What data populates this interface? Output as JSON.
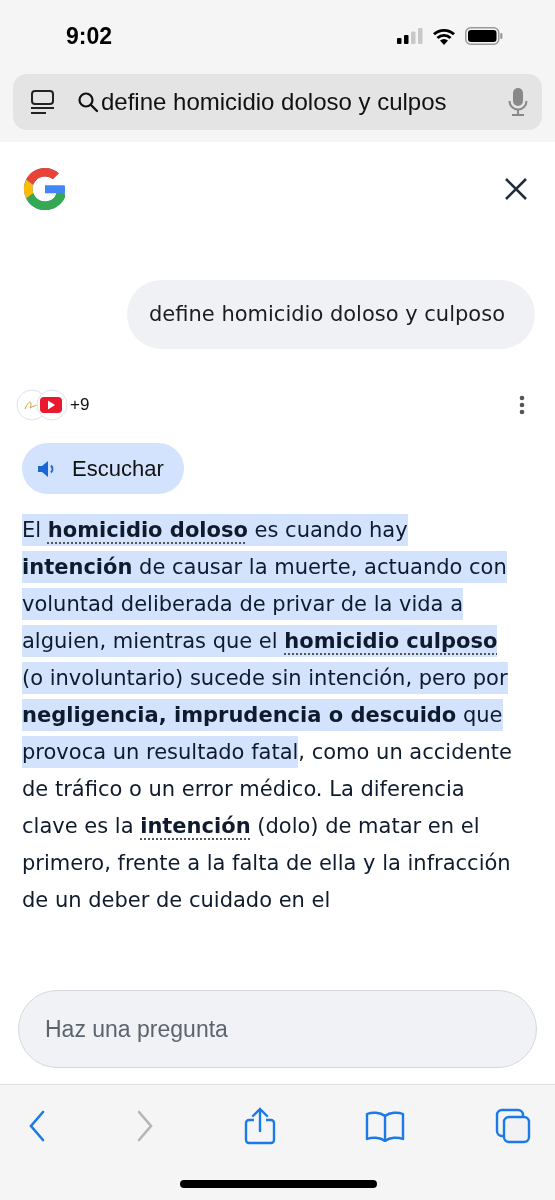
{
  "status_bar": {
    "time": "9:02"
  },
  "address_bar": {
    "query": "define homicidio doloso y culpos"
  },
  "user_message": "define homicidio doloso y culposo",
  "sources": {
    "more_count": "+9"
  },
  "listen_button": "Escuchar",
  "answer": [
    {
      "kind": "plain",
      "text": "El ",
      "highlighted": true
    },
    {
      "kind": "term",
      "text": "homicidio doloso",
      "highlighted": true
    },
    {
      "kind": "plain",
      "text": " es cuando hay ",
      "highlighted": true
    },
    {
      "kind": "bold",
      "text": "intención",
      "highlighted": true
    },
    {
      "kind": "plain",
      "text": " de causar la muerte, actuando con voluntad deliberada de privar de la vida a alguien, mientras que el ",
      "highlighted": true
    },
    {
      "kind": "term",
      "text": "homicidio culposo",
      "highlighted": true
    },
    {
      "kind": "plain",
      "text": " (o involuntario) sucede sin intención, pero por ",
      "highlighted": true
    },
    {
      "kind": "bold",
      "text": "negligencia, imprudencia o descuido",
      "highlighted": true
    },
    {
      "kind": "plain",
      "text": " que provoca un resultado fatal",
      "highlighted": true
    },
    {
      "kind": "plain",
      "text": ", como un accidente de tráfico o un error médico. La diferencia clave es la ",
      "highlighted": false
    },
    {
      "kind": "term",
      "text": "intención",
      "highlighted": false
    },
    {
      "kind": "plain",
      "text": " (dolo) de matar en el primero, frente a la falta de ella y la infracción de un deber de cuidado en el",
      "highlighted": false
    }
  ],
  "ask_field": {
    "placeholder": "Haz una pregunta"
  },
  "toolbar": [
    {
      "kind": "back",
      "disabled": false
    },
    {
      "kind": "forward",
      "disabled": true
    },
    {
      "kind": "share",
      "disabled": false
    },
    {
      "kind": "bookmarks",
      "disabled": false
    },
    {
      "kind": "tabs",
      "disabled": false
    }
  ]
}
